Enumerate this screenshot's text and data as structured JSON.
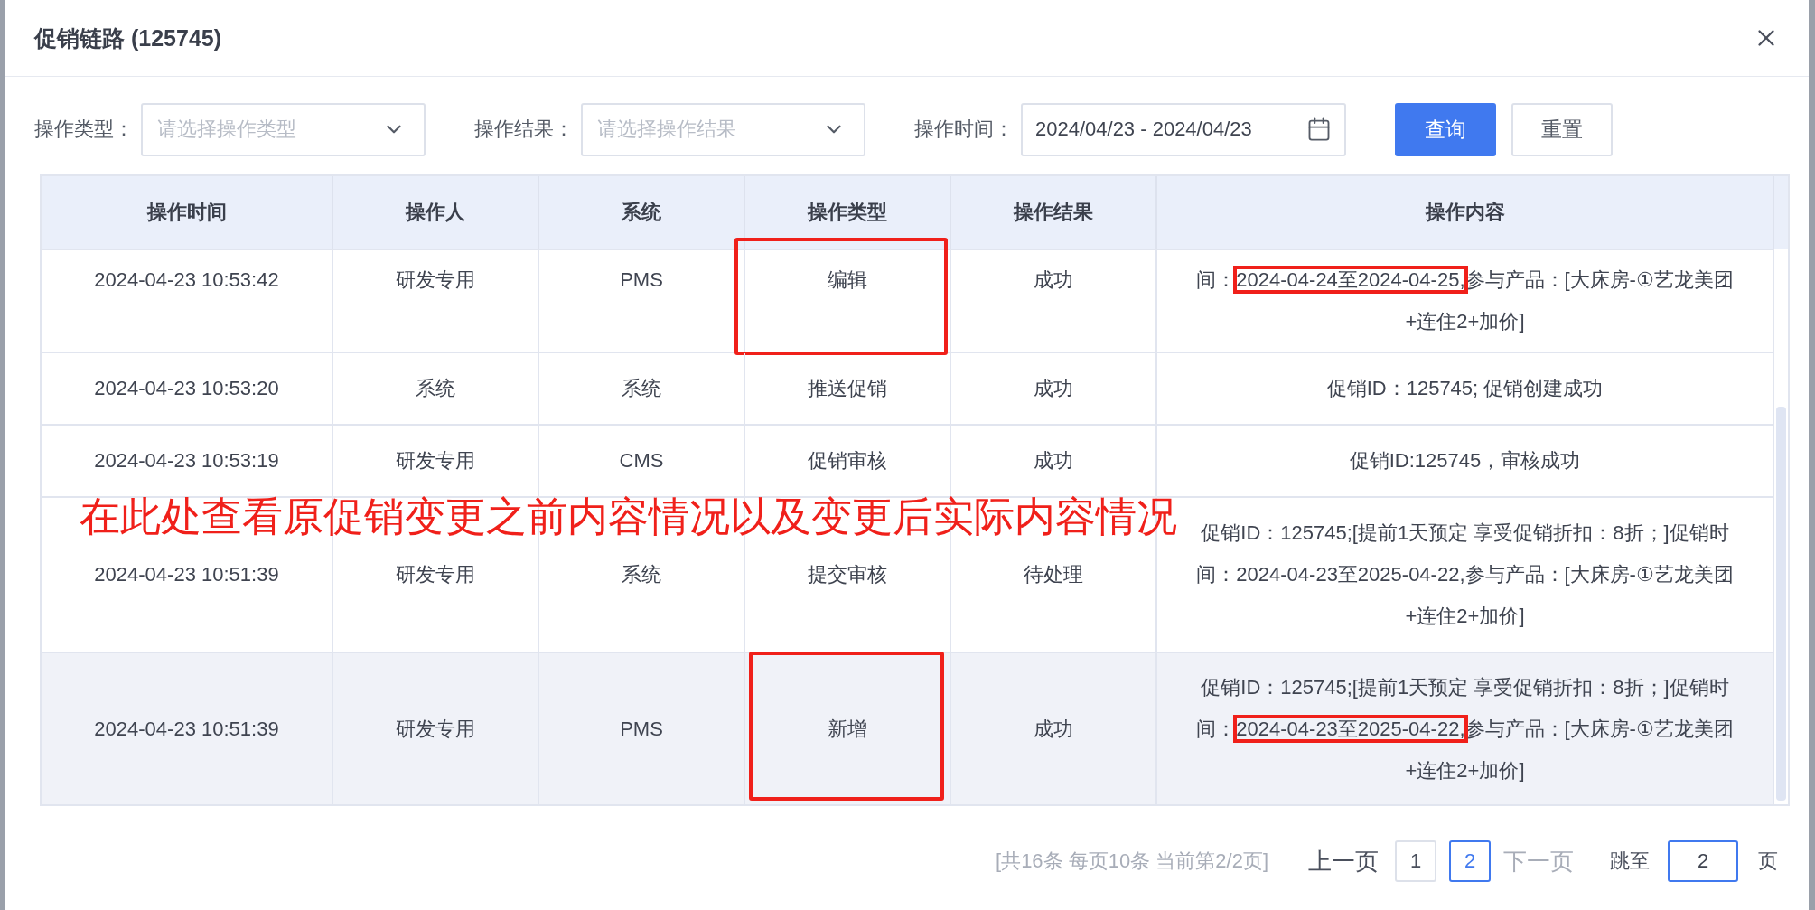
{
  "dialog": {
    "title": "促销链路 (125745)"
  },
  "filters": [
    {
      "kind": "select",
      "label": "操作类型：",
      "placeholder": "请选择操作类型"
    },
    {
      "kind": "select",
      "label": "操作结果：",
      "placeholder": "请选择操作结果"
    },
    {
      "kind": "daterange",
      "label": "操作时间：",
      "value": "2024/04/23 - 2024/04/23"
    }
  ],
  "buttons": [
    {
      "label": "查询",
      "primary": true
    },
    {
      "label": "重置",
      "primary": false
    }
  ],
  "table": {
    "columns": [
      "操作时间",
      "操作人",
      "系统",
      "操作类型",
      "操作结果",
      "操作内容"
    ],
    "rows": [
      {
        "time": "2024-04-23 10:53:42",
        "operator": "研发专用",
        "system": "PMS",
        "type": "编辑",
        "type_marked": true,
        "result": "成功",
        "hovered": false,
        "content": [
          {
            "text": "间：",
            "marked": false
          },
          {
            "text": "2024-04-24至2024-04-25,",
            "marked": true
          },
          {
            "text": "参与产品：[大床房-①艺龙美团+连住2+加价]",
            "marked": false
          }
        ]
      },
      {
        "time": "2024-04-23 10:53:20",
        "operator": "系统",
        "system": "系统",
        "type": "推送促销",
        "type_marked": false,
        "result": "成功",
        "hovered": false,
        "content": [
          {
            "text": "促销ID：125745; 促销创建成功",
            "marked": false
          }
        ]
      },
      {
        "time": "2024-04-23 10:53:19",
        "operator": "研发专用",
        "system": "CMS",
        "type": "促销审核",
        "type_marked": false,
        "result": "成功",
        "hovered": false,
        "content": [
          {
            "text": "促销ID:125745，审核成功",
            "marked": false
          }
        ]
      },
      {
        "time": "2024-04-23 10:51:39",
        "operator": "研发专用",
        "system": "系统",
        "type": "提交审核",
        "type_marked": false,
        "result": "待处理",
        "hovered": false,
        "content": [
          {
            "text": "促销ID：125745;[提前1天预定 享受促销折扣：8折；]促销时间：2024-04-23至2025-04-22,参与产品：[大床房-①艺龙美团+连住2+加价]",
            "marked": false
          }
        ]
      },
      {
        "time": "2024-04-23 10:51:39",
        "operator": "研发专用",
        "system": "PMS",
        "type": "新增",
        "type_marked": true,
        "result": "成功",
        "hovered": true,
        "content": [
          {
            "text": "促销ID：125745;[提前1天预定 享受促销折扣：8折；]促销时间：",
            "marked": false
          },
          {
            "text": "2024-04-23至2025-04-22,",
            "marked": true
          },
          {
            "text": "参与产品：[大床房-①艺龙美团+连住2+加价]",
            "marked": false
          }
        ]
      }
    ]
  },
  "annotation": {
    "text": "在此处查看原促销变更之前内容情况以及变更后实际内容情况"
  },
  "pagination": {
    "summary": "[共16条 每页10条 当前第2/2页]",
    "prev": {
      "label": "上一页",
      "disabled": false
    },
    "pages": [
      {
        "label": "1",
        "selected": false
      },
      {
        "label": "2",
        "selected": true
      }
    ],
    "next": {
      "label": "下一页",
      "disabled": true
    },
    "jump_label": "跳至",
    "jump_value": "2",
    "jump_suffix": "页"
  }
}
